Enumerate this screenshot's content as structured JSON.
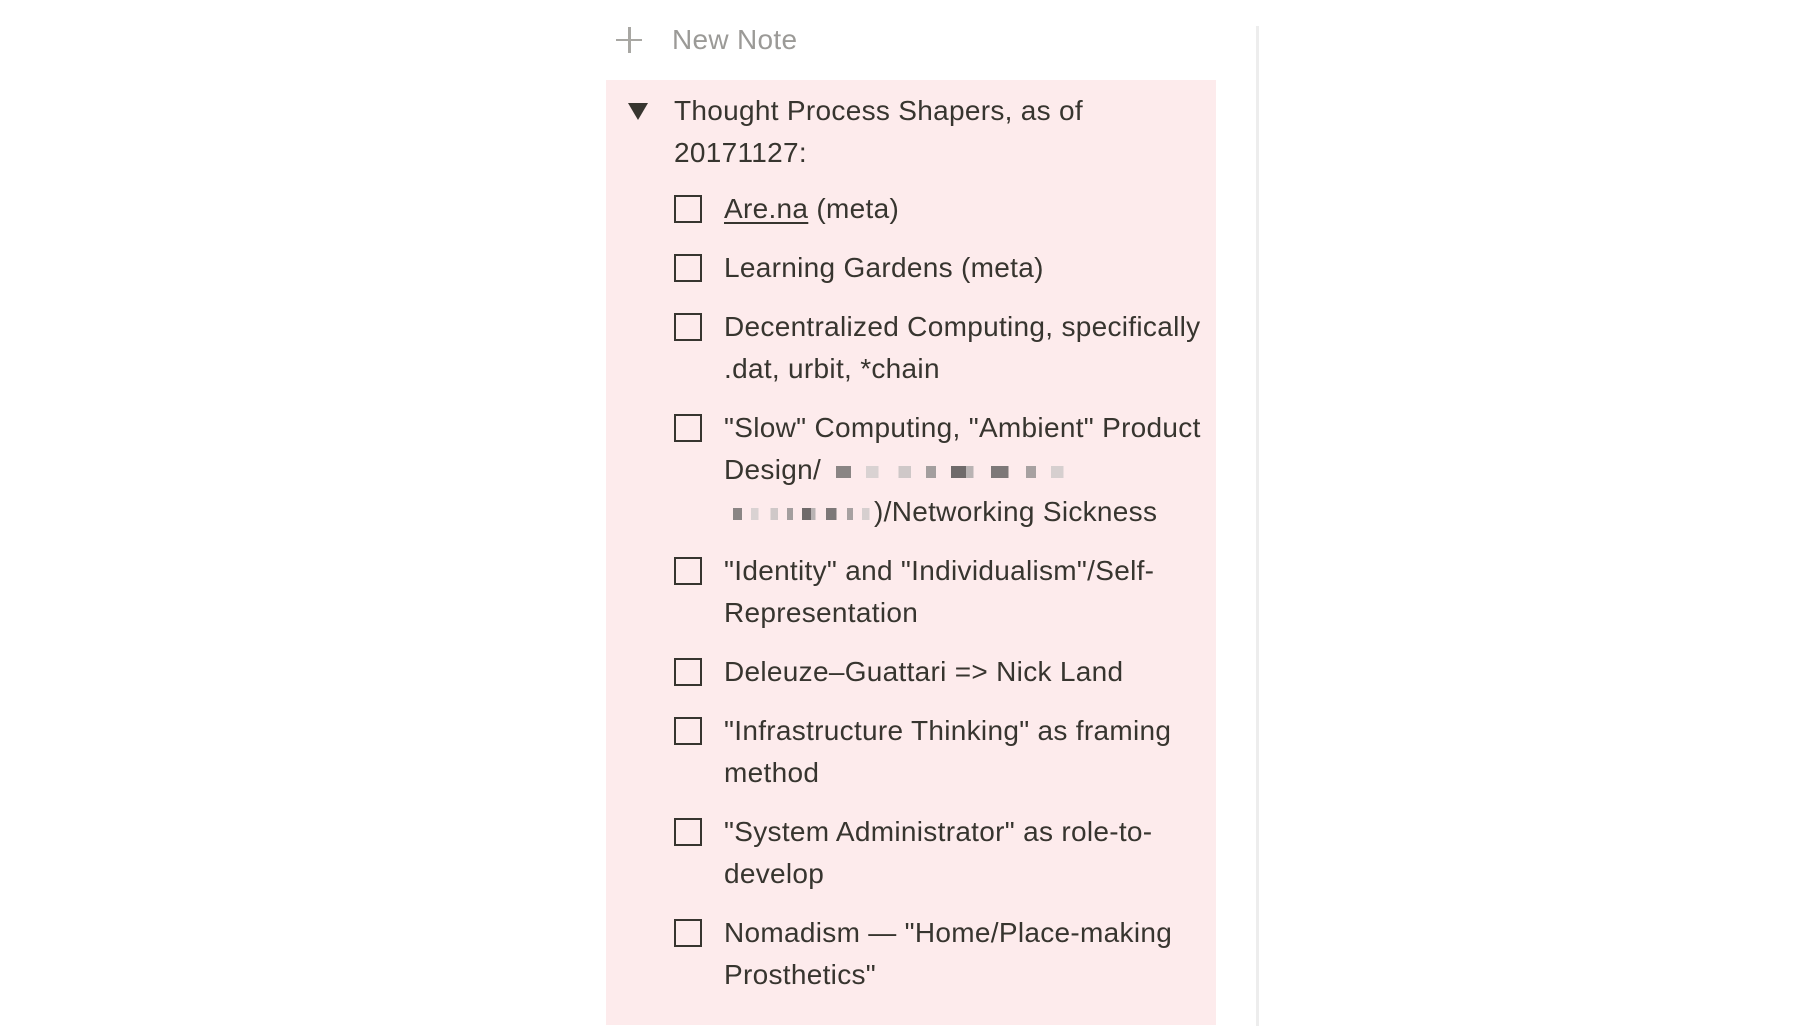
{
  "new_note": {
    "label": "New Note"
  },
  "toggle": {
    "title": "Thought Process Shapers, as of 20171127:"
  },
  "todos": [
    {
      "link": "Are.na",
      "text": " (meta)"
    },
    {
      "text": "Learning Gardens (meta)"
    },
    {
      "text": "Decentralized Computing, specifically .dat, urbit, *chain"
    },
    {
      "text_before": "\"Slow\" Computing, \"Ambient\" Product Design/",
      "text_after": ")/Networking Sickness"
    },
    {
      "text": "\"Identity\" and \"Individualism\"/Self-Representation"
    },
    {
      "text": "Deleuze–Guattari => Nick Land"
    },
    {
      "text": "\"Infrastructure Thinking\" as framing method"
    },
    {
      "text": "\"System Administrator\" as role-to-develop"
    },
    {
      "text": "Nomadism — \"Home/Place-making Prosthetics\""
    }
  ],
  "colors": {
    "block_background": "#fdebec",
    "text": "#37352f",
    "muted": "#9b9a97"
  }
}
